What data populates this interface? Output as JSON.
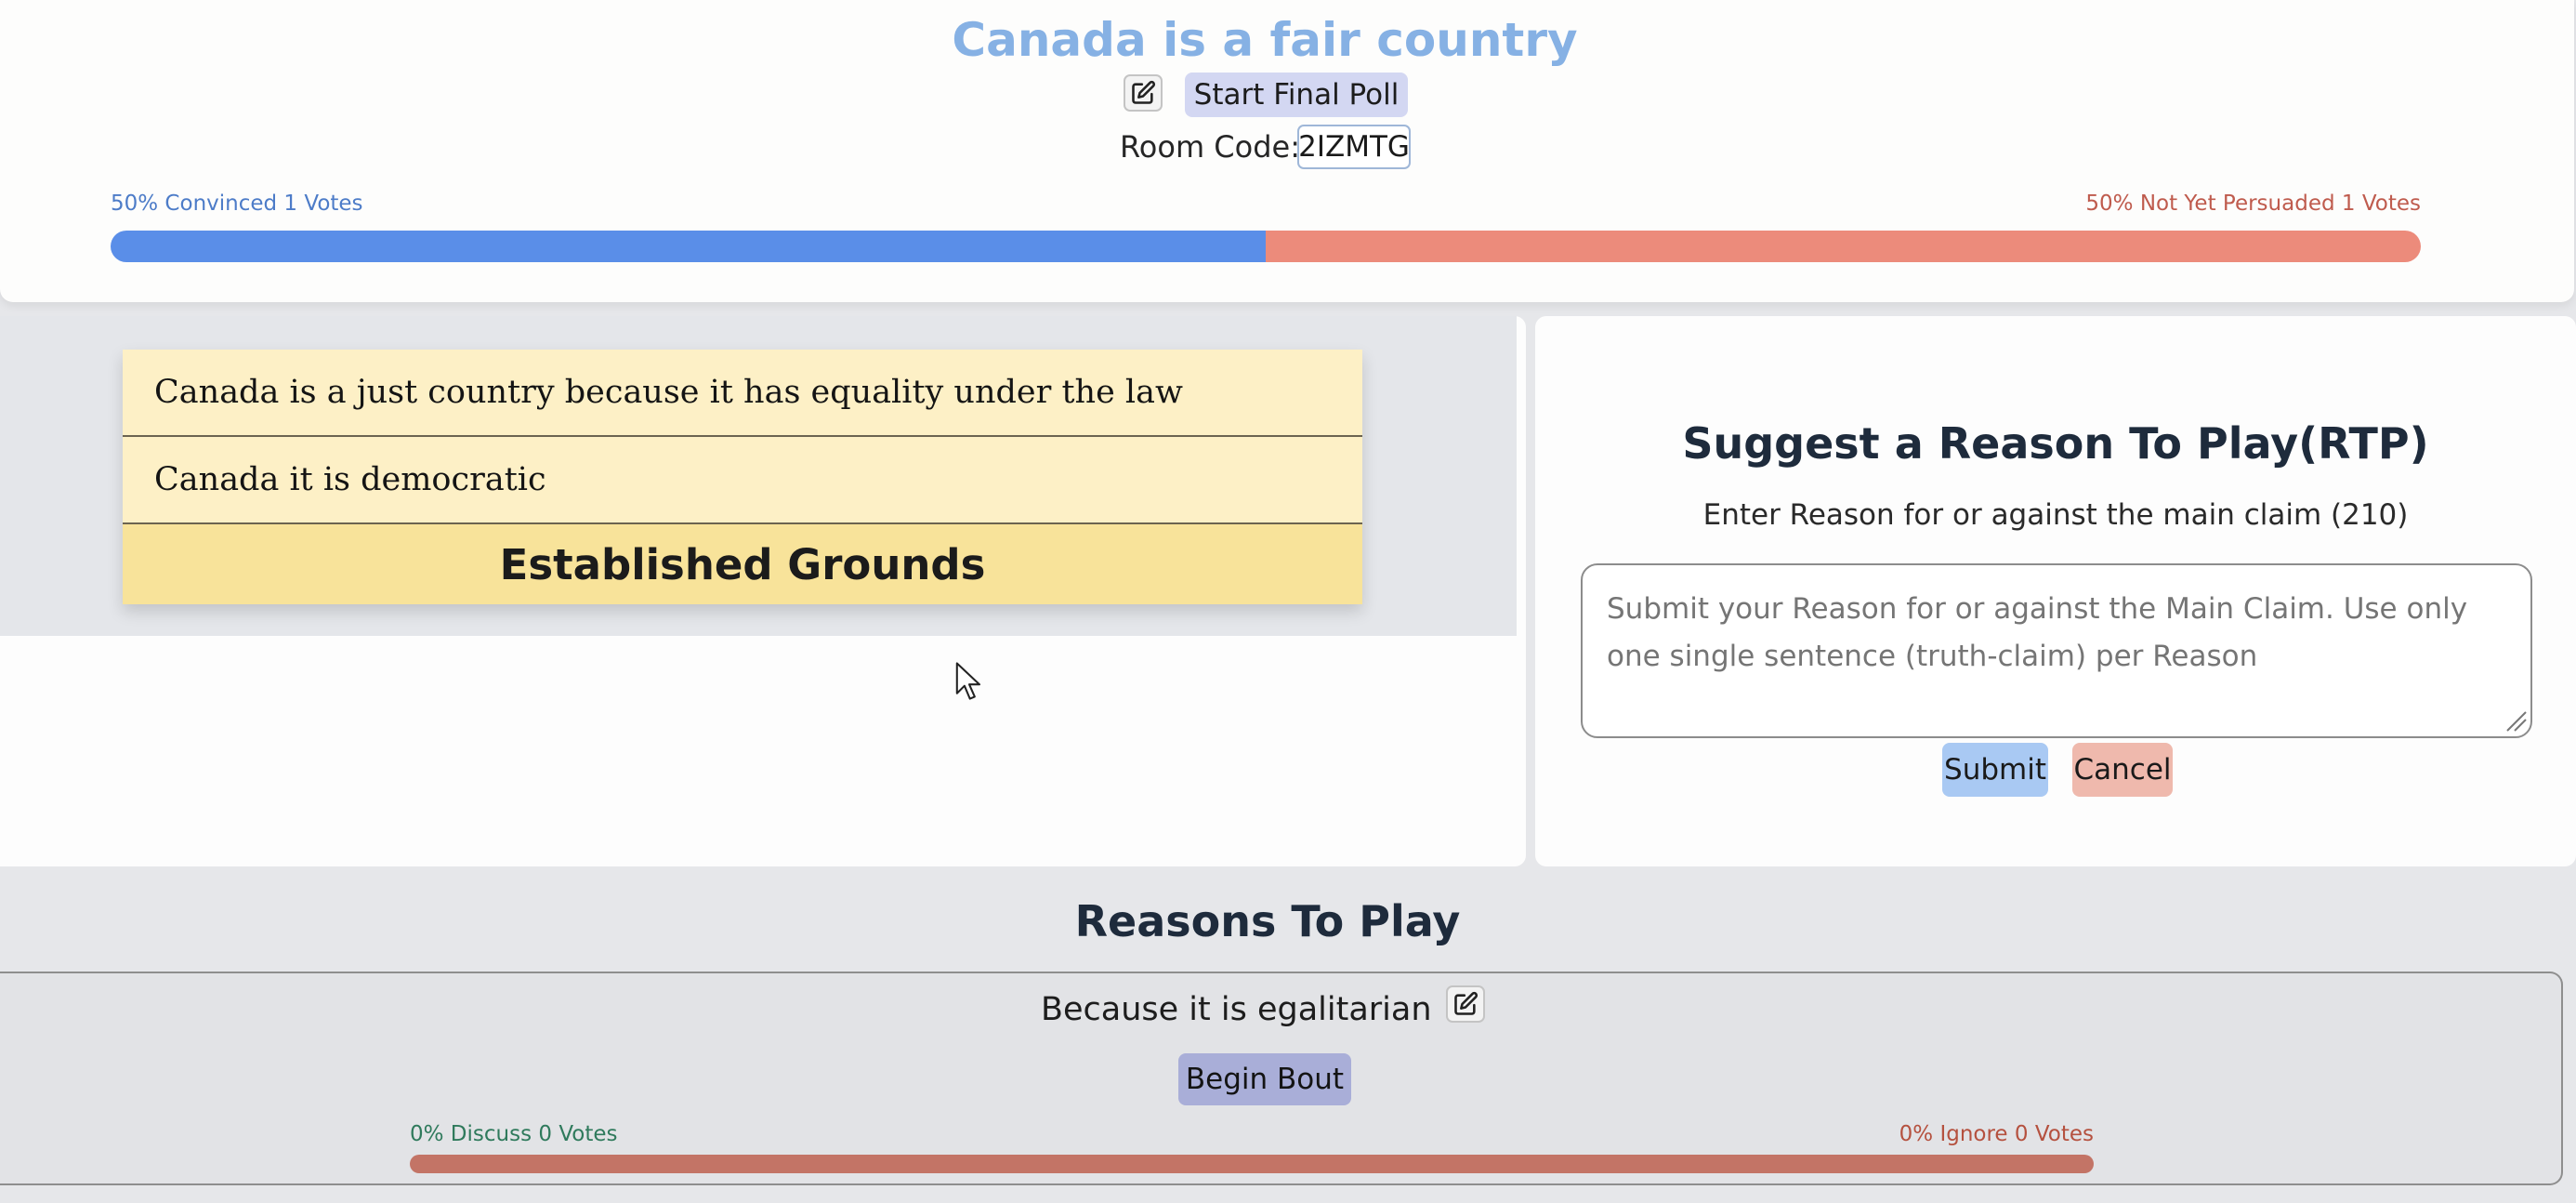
{
  "header": {
    "title": "Canada is a fair country",
    "edit_icon": "edit-icon",
    "poll_button": "Start Final Poll",
    "room_code_label": "Room Code:",
    "room_code": "2IZMTG",
    "convinced_label": "50% Convinced 1 Votes",
    "not_persuaded_label": "50% Not Yet Persuaded 1 Votes",
    "convinced_fraction": 0.5,
    "colors": {
      "convinced": "#5a8ee8",
      "not_persuaded": "#ec8b7b",
      "title": "#86b1e4"
    }
  },
  "grounds": {
    "items": [
      "Canada is a just country because it has equality under the law",
      "Canada it is democratic"
    ],
    "title": "Established Grounds"
  },
  "suggest": {
    "title": "Suggest a Reason To Play(RTP)",
    "subtitle": "Enter Reason for or against the main claim (210)",
    "placeholder": "Submit your Reason for or against the Main Claim. Use only one single sentence (truth-claim) per Reason",
    "submit": "Submit",
    "cancel": "Cancel"
  },
  "reasons": {
    "title": "Reasons To Play",
    "items": [
      {
        "text": "Because it is egalitarian",
        "button": "Begin Bout",
        "discuss_label": "0% Discuss 0 Votes",
        "ignore_label": "0% Ignore 0 Votes",
        "discuss_fraction": 0
      }
    ]
  }
}
